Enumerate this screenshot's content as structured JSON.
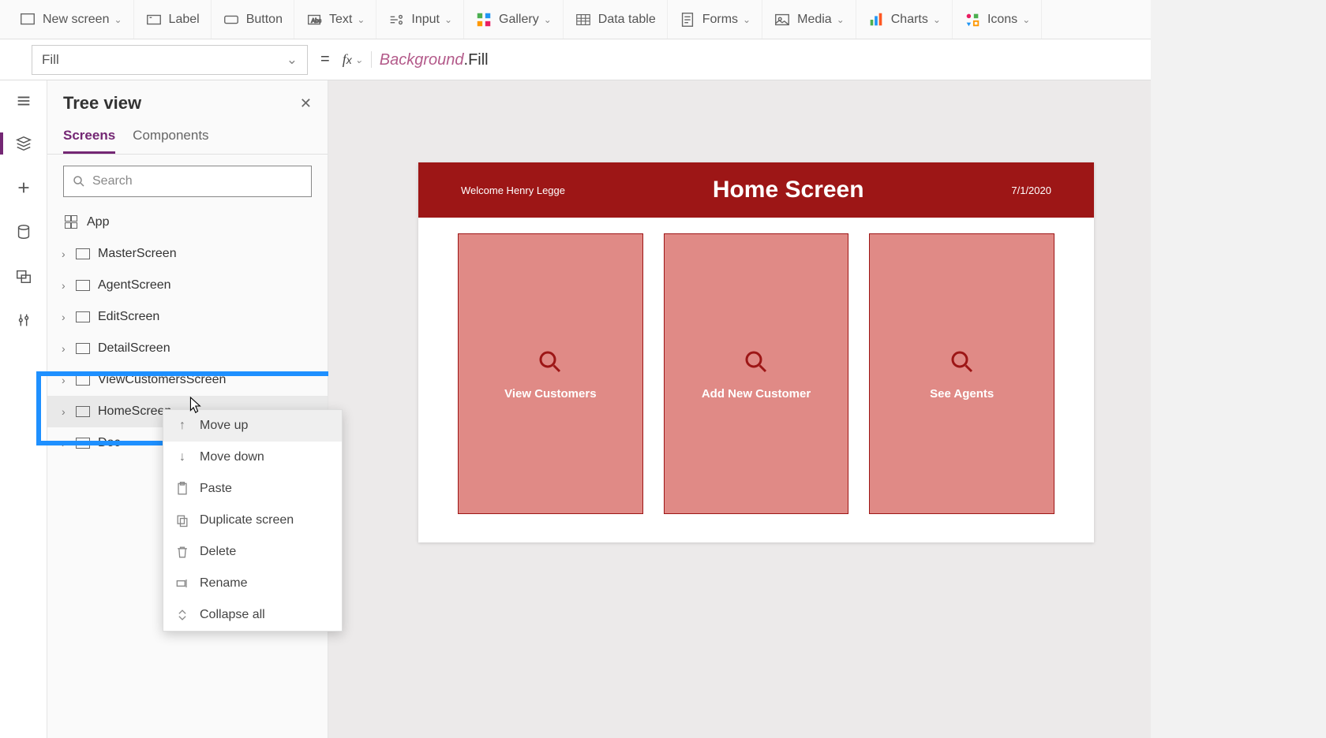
{
  "ribbon": {
    "new_screen": "New screen",
    "label": "Label",
    "button": "Button",
    "text": "Text",
    "input": "Input",
    "gallery": "Gallery",
    "data_table": "Data table",
    "forms": "Forms",
    "media": "Media",
    "charts": "Charts",
    "icons": "Icons"
  },
  "formula": {
    "property": "Fill",
    "expression_obj": "Background",
    "expression_prop": ".Fill"
  },
  "tree": {
    "title": "Tree view",
    "tabs": {
      "screens": "Screens",
      "components": "Components"
    },
    "search_placeholder": "Search",
    "app_label": "App",
    "items": [
      "MasterScreen",
      "AgentScreen",
      "EditScreen",
      "DetailScreen",
      "ViewCustomersScreen",
      "HomeScreen",
      "Doc"
    ]
  },
  "ctx": {
    "move_up": "Move up",
    "move_down": "Move down",
    "paste": "Paste",
    "duplicate": "Duplicate screen",
    "delete": "Delete",
    "rename": "Rename",
    "collapse_all": "Collapse all"
  },
  "preview": {
    "welcome": "Welcome Henry Legge",
    "title": "Home Screen",
    "date": "7/1/2020",
    "tiles": [
      "View Customers",
      "Add New Customer",
      "See Agents"
    ]
  }
}
